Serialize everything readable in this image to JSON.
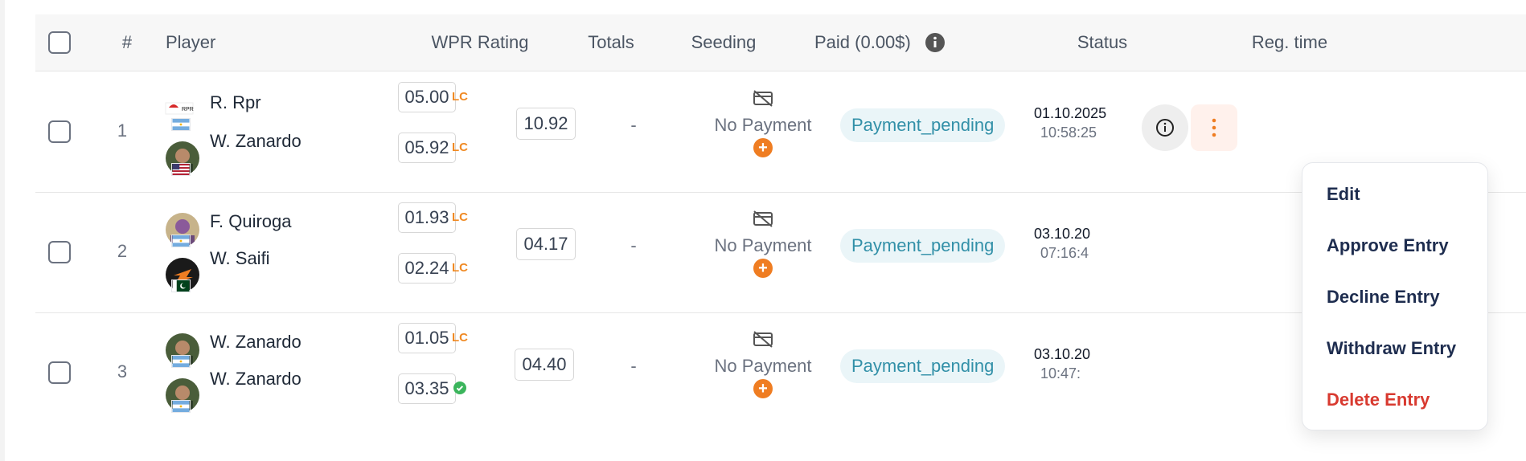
{
  "header": {
    "num": "#",
    "player": "Player",
    "wpr": "WPR Rating",
    "totals": "Totals",
    "seeding": "Seeding",
    "paid": "Paid (0.00$)",
    "status": "Status",
    "reg": "Reg. time"
  },
  "rows": [
    {
      "index": "1",
      "players": [
        {
          "name": "R. Rpr",
          "rating": "05.00",
          "badge": "LC"
        },
        {
          "name": "W. Zanardo",
          "rating": "05.92",
          "badge": "LC"
        }
      ],
      "total": "10.92",
      "seeding": "-",
      "payment": "No Payment",
      "status": "Payment_pending",
      "date": "01.10.2025",
      "time": "10:58:25"
    },
    {
      "index": "2",
      "players": [
        {
          "name": "F. Quiroga",
          "rating": "01.93",
          "badge": "LC"
        },
        {
          "name": "W. Saifi",
          "rating": "02.24",
          "badge": "LC"
        }
      ],
      "total": "04.17",
      "seeding": "-",
      "payment": "No Payment",
      "status": "Payment_pending",
      "date": "03.10.20",
      "time": "07:16:4"
    },
    {
      "index": "3",
      "players": [
        {
          "name": "W. Zanardo",
          "rating": "01.05",
          "badge": "LC"
        },
        {
          "name": "W. Zanardo",
          "rating": "03.35",
          "badge": "verified"
        }
      ],
      "total": "04.40",
      "seeding": "-",
      "payment": "No Payment",
      "status": "Payment_pending",
      "date": "03.10.20",
      "time": "10:47:"
    }
  ],
  "menu": {
    "edit": "Edit",
    "approve": "Approve Entry",
    "decline": "Decline Entry",
    "withdraw": "Withdraw Entry",
    "delete": "Delete Entry"
  },
  "colors": {
    "accent": "#ef7d22",
    "status_text": "#3290a8",
    "status_bg": "#eaf5f8",
    "menu_text": "#1e2d4f",
    "danger": "#d83a30",
    "verified": "#3bb55c"
  }
}
